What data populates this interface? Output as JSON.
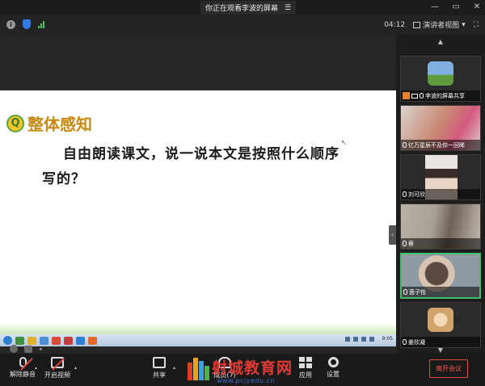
{
  "titlebar": {
    "share_banner": "你正在观看李波的屏幕",
    "banner_icon": "view-options-icon",
    "window_buttons": [
      "—",
      "▭",
      "✕"
    ]
  },
  "statusbar": {
    "timer": "04:12",
    "view_label": "演讲者视图",
    "view_caret": "▾"
  },
  "slide": {
    "title": "整体感知",
    "icon_letter": "Q",
    "body": "自由朗读课文，说一说本文是按照什么顺序写的？"
  },
  "taskbar": {
    "clock": "9:05"
  },
  "gallery": {
    "up_arrow": "▲",
    "down_arrow": "▼",
    "participants": [
      {
        "name": "李波的屏幕共享",
        "avatar_color": "#7fb0e0",
        "host": true
      },
      {
        "name": "亿万星辰不及你一回眸",
        "avatar_color": "#c98a74"
      },
      {
        "name": "刘可欣",
        "avatar_color": "#e9e4df"
      },
      {
        "name": "蔡",
        "avatar_color": "#a8a095"
      },
      {
        "name": "茵子怡",
        "avatar_color": "#8f9aa2"
      },
      {
        "name": "姜欣凝",
        "avatar_color": "#cfa36a"
      }
    ]
  },
  "toolbar": {
    "unmute": "解除静音",
    "start_video": "开启视频",
    "share": "共享",
    "members": "成员(7)",
    "apps": "应用",
    "settings": "设置",
    "leave": "离开会议"
  },
  "watermark": {
    "title": "射城教育网",
    "url": "www.pcjyedu.cn"
  },
  "colors": {
    "accent_green": "#3fbf6a",
    "leave_red": "#e24a3c",
    "slide_title": "#c98a12"
  }
}
